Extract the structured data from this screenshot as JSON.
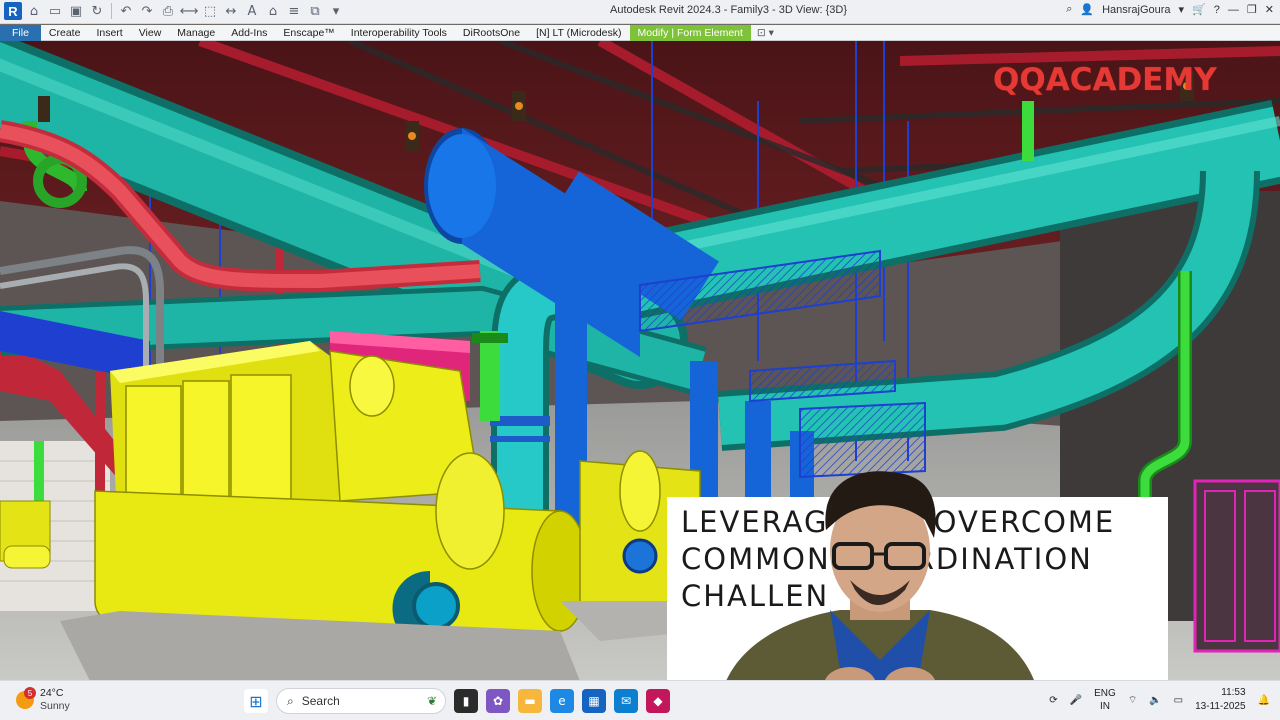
{
  "window": {
    "title": "Autodesk Revit 2024.3 - Family3 - 3D View: {3D}",
    "user": "HansrajGoura"
  },
  "menu": {
    "tabs": [
      "File",
      "Create",
      "Insert",
      "View",
      "Manage",
      "Add-Ins",
      "Enscape™",
      "Interoperability Tools",
      "DiRootsOne",
      "[N] LT (Microdesk)",
      "Modify | Form Element"
    ]
  },
  "overlay": {
    "brand": "QQACADEMY",
    "title_lines": [
      "LEVERAG   M TO OVERCOME",
      "COMMON      COORDINATION",
      "CHALLEN"
    ]
  },
  "taskbar": {
    "temp": "24°C",
    "condition": "Sunny",
    "weather_badge": "5",
    "search_placeholder": "Search",
    "lang1": "ENG",
    "lang2": "IN",
    "time": "11:53",
    "date": "13-11-2025"
  },
  "colors": {
    "teal_pipe": "#1fb5a6",
    "blue_pipe": "#1565d8",
    "chiller": "#ffff33",
    "red_steel": "#c0283a",
    "brand_red": "#e53935",
    "modify_tab": "#7ec23a"
  }
}
